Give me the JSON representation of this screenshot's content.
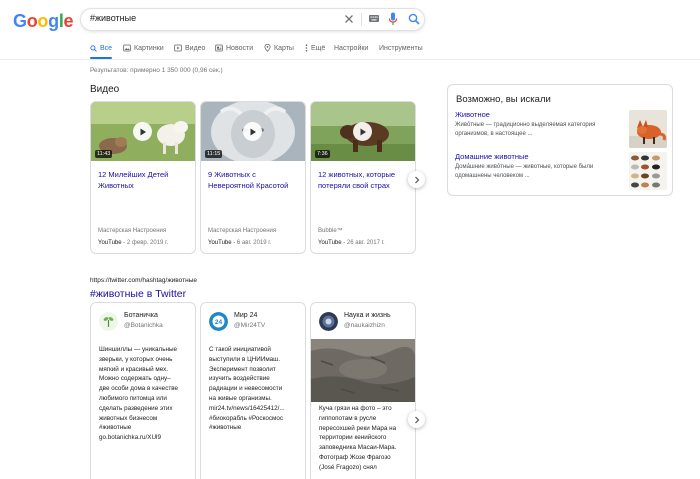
{
  "header": {
    "logo": "Google",
    "search": {
      "value": "#животные"
    }
  },
  "tabs": [
    {
      "label": "Все",
      "icon": "search-icon",
      "active": true
    },
    {
      "label": "Картинки",
      "icon": "image-icon"
    },
    {
      "label": "Видео",
      "icon": "video-icon"
    },
    {
      "label": "Новости",
      "icon": "news-icon"
    },
    {
      "label": "Карты",
      "icon": "map-pin-icon"
    },
    {
      "label": "Ещё",
      "icon": "more-vert-icon"
    },
    {
      "label": "Настройки"
    },
    {
      "label": "Инструменты"
    }
  ],
  "result_stats": "Результатов: примерно 1 350 000 (0,96 сек.)",
  "videos": {
    "heading": "Видео",
    "items": [
      {
        "title": "12 Милейших Детей Животных",
        "duration": "11:43",
        "channel": "Мастерская Настроения",
        "platform": "YouTube",
        "date": "- 2 февр. 2019 г."
      },
      {
        "title": "9 Животных с Невероятной Красотой",
        "duration": "11:15",
        "channel": "Мастерская Настроения",
        "platform": "YouTube",
        "date": "- 6 авг. 2019 г."
      },
      {
        "title": "12 животных, которые потеряли свой страх",
        "duration": "7:36",
        "channel": "Bubble™",
        "platform": "YouTube",
        "date": "- 26 авг. 2017 г."
      }
    ]
  },
  "knowledge_panel": {
    "title": "Возможно, вы искали",
    "items": [
      {
        "name": "Животное",
        "desc": "Живо́тные — традиционно выделяемая категория организмов, в настоящее ..."
      },
      {
        "name": "Домашние животные",
        "desc": "Дома́шние живо́тные — животные, которые были одомашнены человеком ..."
      }
    ]
  },
  "twitter": {
    "url": "https://twitter.com/hashtag/животные",
    "title": "#животные в Twitter",
    "tweets": [
      {
        "name": "Ботаничка",
        "handle": "@Botanichka",
        "text": "Шиншиллы — уникальные\nзверьки, у которых очень\nмягкий и красивый мех.\nМожно содержать одну–\nдве особи дома в качестве\nлюбимого питомца или\nсделать разведение этих\nживотных бизнесом\n#животные\ngo.botanichka.ru/XUl9"
      },
      {
        "name": "Мир 24",
        "handle": "@Mir24TV",
        "text": "С такой инициативой\nвыступили в ЦНИИмаш.\nЭксперимент позволит\nизучить воздействие\nрадиации и невесомости\nна живые организмы.\nmir24.tv/news/16425412/...\n#биокорабль #Роскосмос\n#животные"
      },
      {
        "name": "Наука и жизнь",
        "handle": "@naukaizhizn",
        "text": "Куча грязи на фото – это\nгиппопотам в русле\nпересохшей реки Мара на\nтерритории кенийского\nзаповедника Масаи-Мара.\nФотограф Жозе Фрагозо\n(José Fragozo) снял"
      }
    ]
  },
  "colors": {
    "link": "#1a0dab",
    "accent": "#1a73e8",
    "muted": "#70757a",
    "google_blue": "#4285f4",
    "google_red": "#ea4335",
    "google_yellow": "#fbbc05",
    "google_green": "#34a853"
  }
}
